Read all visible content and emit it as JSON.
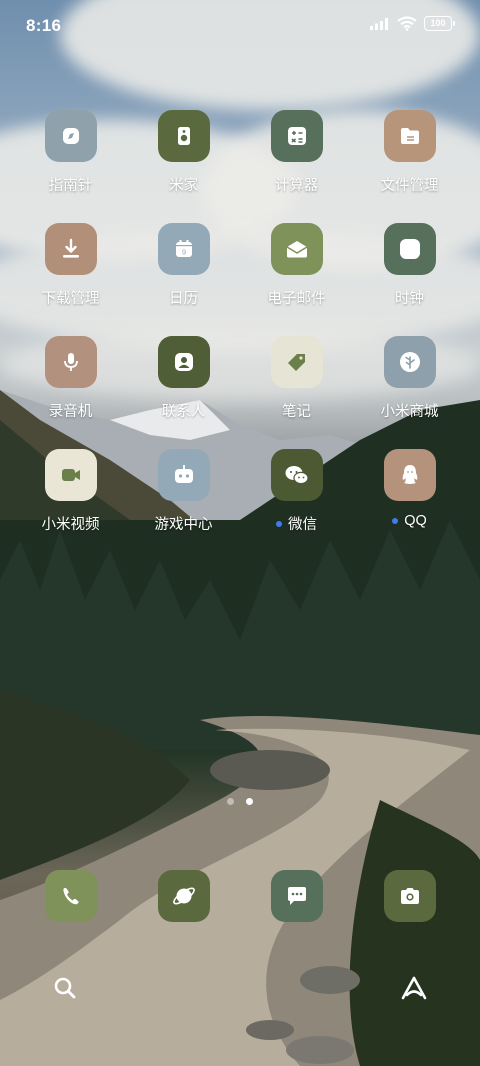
{
  "status_bar": {
    "time": "8:16",
    "battery": "100",
    "icons": [
      "signal-icon",
      "wifi-icon",
      "battery-icon"
    ]
  },
  "apps": [
    {
      "label": "指南针",
      "icon": "compass-icon",
      "color": "#8fa2ab",
      "notify": false
    },
    {
      "label": "米家",
      "icon": "speaker-icon",
      "color": "#5b6a3e",
      "notify": false
    },
    {
      "label": "计算器",
      "icon": "calculator-icon",
      "color": "#56705c",
      "notify": false
    },
    {
      "label": "文件管理",
      "icon": "folder-icon",
      "color": "#b7957a",
      "notify": false
    },
    {
      "label": "下载管理",
      "icon": "download-icon",
      "color": "#b28f79",
      "notify": false
    },
    {
      "label": "日历",
      "icon": "calendar-icon",
      "color": "#93a9b8",
      "notify": false
    },
    {
      "label": "电子邮件",
      "icon": "mail-icon",
      "color": "#7e9259",
      "notify": false
    },
    {
      "label": "时钟",
      "icon": "clock-icon",
      "color": "#56705c",
      "notify": false
    },
    {
      "label": "录音机",
      "icon": "microphone-icon",
      "color": "#b2917f",
      "notify": false
    },
    {
      "label": "联系人",
      "icon": "contacts-icon",
      "color": "#4f5e36",
      "notify": false
    },
    {
      "label": "笔记",
      "icon": "tag-icon",
      "color": "#e6e4d4",
      "notify": false
    },
    {
      "label": "小米商城",
      "icon": "tree-icon",
      "color": "#8ea0ab",
      "notify": false
    },
    {
      "label": "小米视频",
      "icon": "video-icon",
      "color": "#e9e6d6",
      "notify": false
    },
    {
      "label": "游戏中心",
      "icon": "game-icon",
      "color": "#93a9b8",
      "notify": false
    },
    {
      "label": "微信",
      "icon": "wechat-icon",
      "color": "#4b5a33",
      "notify": true
    },
    {
      "label": "QQ",
      "icon": "qq-penguin-icon",
      "color": "#b5927b",
      "notify": true
    }
  ],
  "pager": {
    "total": 2,
    "active": 1
  },
  "dock": [
    {
      "icon": "phone-icon",
      "color": "#7e9259"
    },
    {
      "icon": "browser-planet-icon",
      "color": "#5b6a3e"
    },
    {
      "icon": "message-icon",
      "color": "#56705c"
    },
    {
      "icon": "camera-icon",
      "color": "#5b6a3e"
    }
  ],
  "bottom_bar": {
    "left": "search-icon",
    "right": "assistant-icon"
  }
}
